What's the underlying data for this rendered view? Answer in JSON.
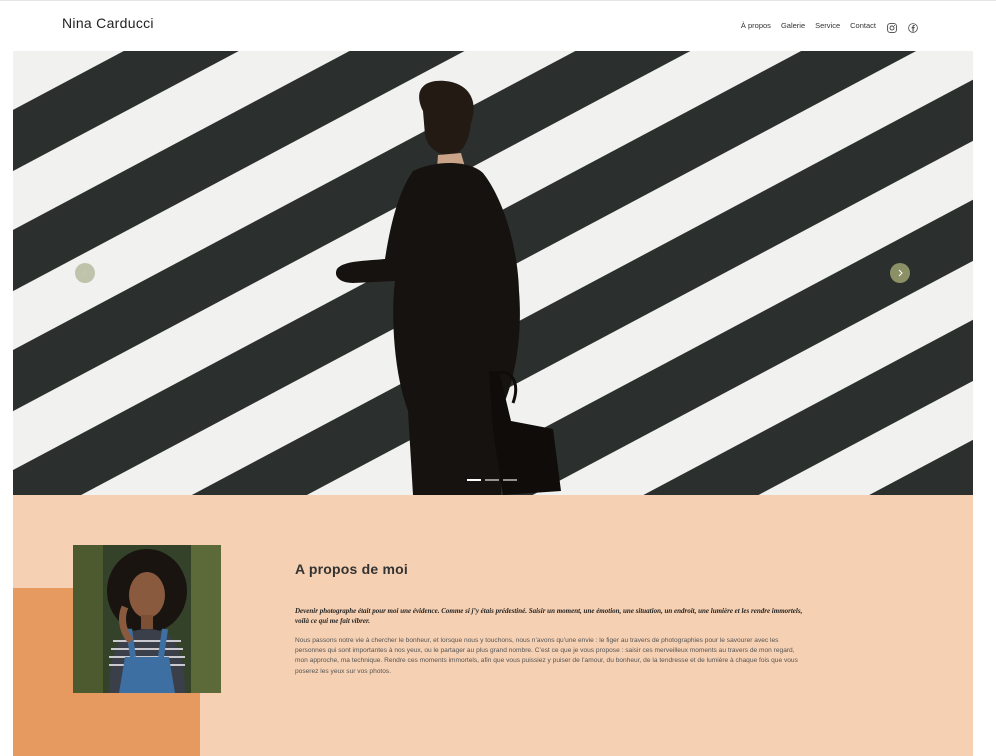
{
  "header": {
    "brand": "Nina Carducci",
    "nav": [
      "À propos",
      "Galerie",
      "Service",
      "Contact"
    ],
    "social_icons": [
      "instagram-icon",
      "facebook-icon"
    ]
  },
  "hero": {
    "image": "man-in-suit-crossing-zebra-crosswalk",
    "slides_total": 3,
    "active_slide": 1,
    "arrow_icons": [
      "chevron-left-icon",
      "chevron-right-icon"
    ]
  },
  "about": {
    "title": "A propos de moi",
    "intro": "Devenir photographe était pour moi une évidence. Comme si j’y étais prédestiné. Saisir un moment, une émotion, une situation, un endroit, une lumière et les rendre immortels, voilà ce qui me fait vibrer.",
    "body": "Nous passons notre vie à chercher le bonheur, et lorsque nous y touchons, nous n’avons qu’une envie : le figer au travers de photographies pour le savourer avec les personnes qui sont importantes à nos yeux, ou le partager au plus grand nombre. C’est ce que je vous propose : saisir ces merveilleux moments au travers de mon regard, mon approche, ma technique. Rendre ces moments immortels, afin que vous puissiez y puiser de l’amour, du bonheur, de la tendresse et de lumière à chaque fois que vous poserez les yeux sur vos photos.",
    "portrait": "woman-portrait-striped-shirt-denim-overalls"
  },
  "colors": {
    "about_bg": "#f5d0b2",
    "accent": "#e69a5f",
    "arrow": "#969b6e"
  }
}
